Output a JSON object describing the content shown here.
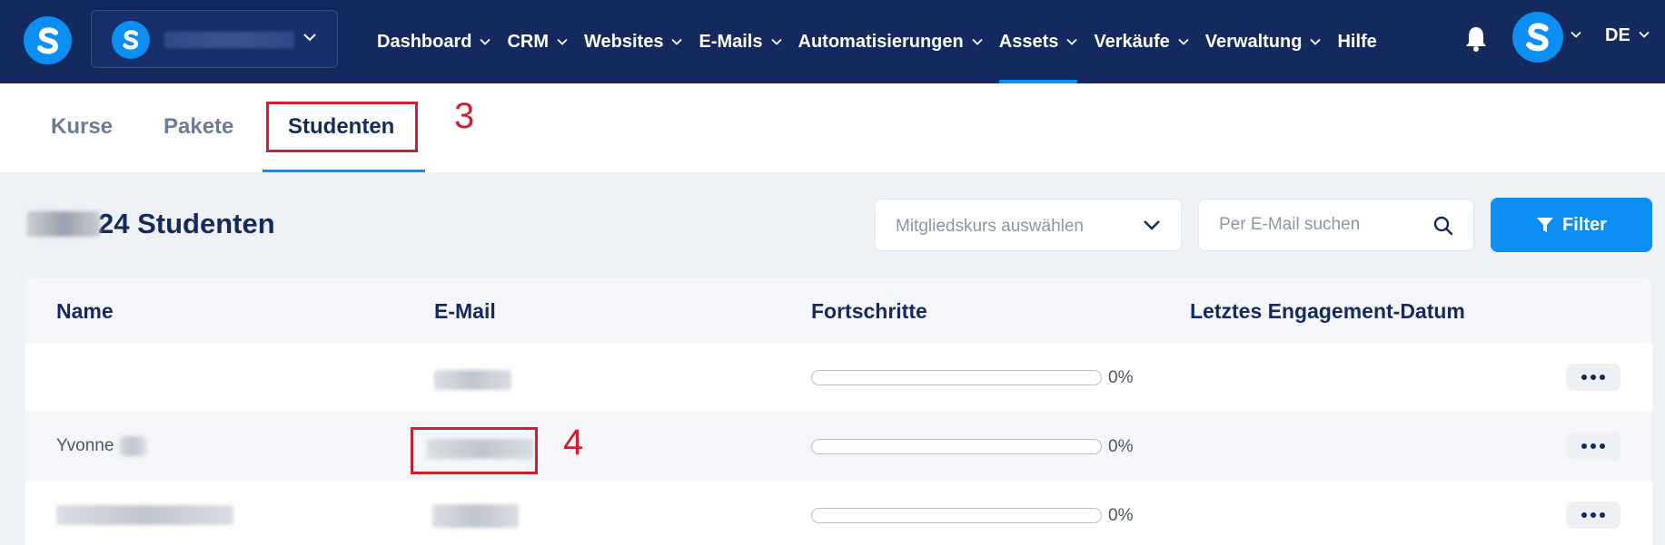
{
  "nav": {
    "items": [
      {
        "label": "Dashboard"
      },
      {
        "label": "CRM"
      },
      {
        "label": "Websites"
      },
      {
        "label": "E-Mails"
      },
      {
        "label": "Automatisierungen"
      },
      {
        "label": "Assets"
      },
      {
        "label": "Verkäufe"
      },
      {
        "label": "Verwaltung"
      }
    ],
    "active": "Assets",
    "help": "Hilfe",
    "language": "DE"
  },
  "subtabs": {
    "items": [
      {
        "label": "Kurse"
      },
      {
        "label": "Pakete"
      },
      {
        "label": "Studenten"
      }
    ],
    "active": "Studenten"
  },
  "annotations": {
    "step_3": "3",
    "step_4": "4"
  },
  "toolbar": {
    "title_suffix": "24 Studenten",
    "course_select_placeholder": "Mitgliedskurs auswählen",
    "search_placeholder": "Per E-Mail suchen",
    "filter_label": "Filter"
  },
  "table": {
    "headers": {
      "name": "Name",
      "email": "E-Mail",
      "progress": "Fortschritte",
      "last_engagement": "Letztes Engagement-Datum"
    },
    "rows": [
      {
        "name": "",
        "progress_percent": 0,
        "progress_label": "0%"
      },
      {
        "name": "Yvonne",
        "progress_percent": 0,
        "progress_label": "0%"
      },
      {
        "name": "",
        "progress_percent": 0,
        "progress_label": "0%"
      }
    ]
  },
  "colors": {
    "nav_bg": "#14295e",
    "accent": "#0b8ff5",
    "annotation": "#d0202f"
  }
}
